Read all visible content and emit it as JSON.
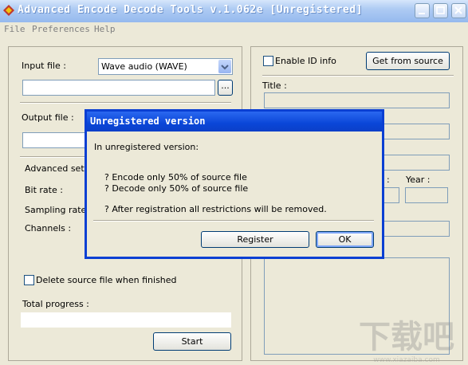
{
  "window": {
    "title": "Advanced Encode Decode Tools v.1.062e [Unregistered]"
  },
  "menu": [
    "File",
    "Preferences",
    "Help"
  ],
  "left": {
    "input_label": "Input file :",
    "input_type": "Wave audio (WAVE)",
    "browse": "...",
    "output_label": "Output file :",
    "advanced_label": "Advanced setti",
    "bitrate_label": "Bit rate :",
    "sampling_label": "Sampling rate :",
    "channels_label": "Channels :",
    "delete_label": "Delete source file when finished",
    "progress_label": "Total progress :",
    "start": "Start"
  },
  "right": {
    "enable_id": "Enable ID info",
    "get_source": "Get from source",
    "title_label": "Title :",
    "colon_partial": ":",
    "year_label": "Year :"
  },
  "dialog": {
    "title": "Unregistered version",
    "intro": "In unregistered version:",
    "line1": "? Encode only 50% of source file",
    "line2": "? Decode only 50% of source file",
    "line3": "? After registration all restrictions will be removed.",
    "register": "Register",
    "ok": "OK"
  },
  "watermark": {
    "text": "下载吧",
    "url": "www.xiazaiba.com"
  }
}
